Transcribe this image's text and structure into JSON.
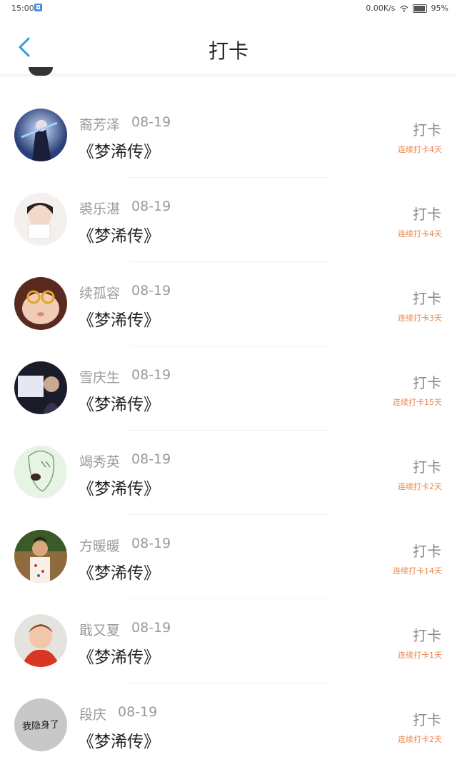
{
  "status": {
    "time": "15:00",
    "speed": "0.00K/s",
    "battery": "95%",
    "battery_level": 0.95
  },
  "header": {
    "title": "打卡"
  },
  "colors": {
    "accent": "#2f9be0",
    "streak": "#e8844b"
  },
  "rows": [
    {
      "name": "裔芳泽",
      "date": "08-19",
      "book": "《梦浠传》",
      "action": "打卡",
      "streak": "连续打卡4天"
    },
    {
      "name": "裘乐湛",
      "date": "08-19",
      "book": "《梦浠传》",
      "action": "打卡",
      "streak": "连续打卡4天"
    },
    {
      "name": "续孤容",
      "date": "08-19",
      "book": "《梦浠传》",
      "action": "打卡",
      "streak": "连续打卡3天"
    },
    {
      "name": "雪庆生",
      "date": "08-19",
      "book": "《梦浠传》",
      "action": "打卡",
      "streak": "连续打卡15天"
    },
    {
      "name": "竭秀英",
      "date": "08-19",
      "book": "《梦浠传》",
      "action": "打卡",
      "streak": "连续打卡2天"
    },
    {
      "name": "方暖暖",
      "date": "08-19",
      "book": "《梦浠传》",
      "action": "打卡",
      "streak": "连续打卡14天"
    },
    {
      "name": "戢又夏",
      "date": "08-19",
      "book": "《梦浠传》",
      "action": "打卡",
      "streak": "连续打卡1天"
    },
    {
      "name": "段庆",
      "date": "08-19",
      "book": "《梦浠传》",
      "action": "打卡",
      "streak": "连续打卡2天",
      "avatar_text": "我隐身了"
    }
  ]
}
